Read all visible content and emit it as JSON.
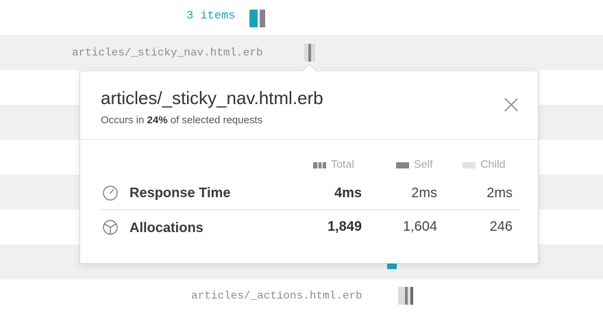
{
  "top": {
    "count_label": "3 items"
  },
  "rows": [
    {
      "file": "articles/_sticky_nav.html.erb"
    },
    {
      "file": "articles/_actions.html.erb"
    }
  ],
  "popover": {
    "title": "articles/_sticky_nav.html.erb",
    "occurs_prefix": "Occurs in",
    "occurs_pct": "24%",
    "occurs_suffix": "of selected requests",
    "legend": {
      "total": "Total",
      "self": "Self",
      "child": "Child"
    },
    "metrics": [
      {
        "label": "Response Time",
        "icon": "speedometer-icon",
        "total": "4ms",
        "self": "2ms",
        "child": "2ms"
      },
      {
        "label": "Allocations",
        "icon": "pie-chart-icon",
        "total": "1,849",
        "self": "1,604",
        "child": "246"
      }
    ]
  },
  "colors": {
    "accent": "#1aa3b8",
    "self": "#8a7f8c",
    "child": "#e2e2e2",
    "stripe": "#f0f0f0"
  }
}
